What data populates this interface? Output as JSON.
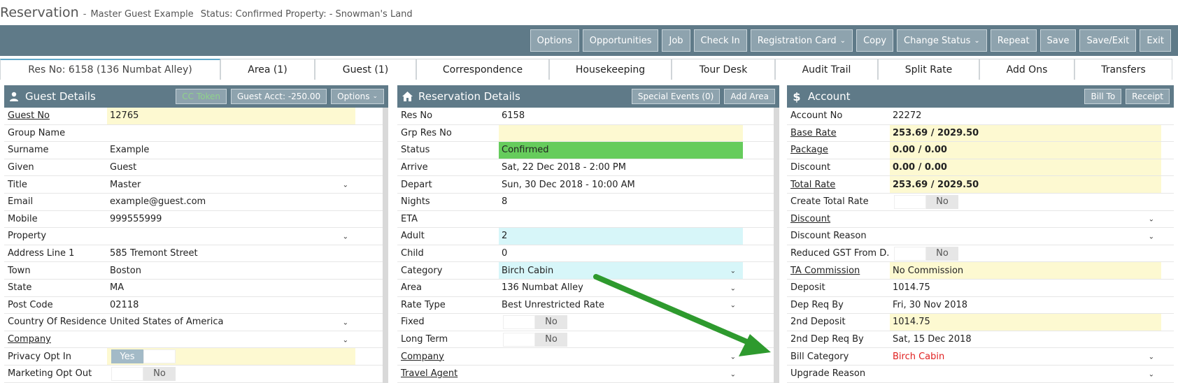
{
  "header": {
    "title": "Reservation",
    "separator": "-",
    "guest": "Master Guest Example",
    "status": "Status: Confirmed",
    "property": "Property: - Snowman's Land"
  },
  "toolbar": {
    "buttons": [
      "Options",
      "Opportunities",
      "Job",
      "Check In",
      "Registration Card",
      "Copy",
      "Change Status",
      "Repeat",
      "Save",
      "Save/Exit",
      "Exit"
    ]
  },
  "tabs": [
    "Res No: 6158 (136 Numbat Alley)",
    "Area (1)",
    "Guest (1)",
    "Correspondence",
    "Housekeeping",
    "Tour Desk",
    "Audit Trail",
    "Split Rate",
    "Add Ons",
    "Transfers"
  ],
  "guest_panel": {
    "title": "Guest Details",
    "cc_token": "CC Token",
    "guest_acct": "Guest Acct: -250.00",
    "options": "Options",
    "rows": [
      {
        "label": "Guest No",
        "value": "12765"
      },
      {
        "label": "Group Name",
        "value": ""
      },
      {
        "label": "Surname",
        "value": "Example"
      },
      {
        "label": "Given",
        "value": "Guest"
      },
      {
        "label": "Title",
        "value": "Master"
      },
      {
        "label": "Email",
        "value": "example@guest.com"
      },
      {
        "label": "Mobile",
        "value": "999555999"
      },
      {
        "label": "Property",
        "value": ""
      },
      {
        "label": "Address Line 1",
        "value": "585 Tremont Street"
      },
      {
        "label": "Town",
        "value": "Boston"
      },
      {
        "label": "State",
        "value": "MA"
      },
      {
        "label": "Post Code",
        "value": "02118"
      },
      {
        "label": "Country Of Residence",
        "value": "United States of America"
      },
      {
        "label": "Company",
        "value": ""
      },
      {
        "label": "Privacy Opt In",
        "value": "Yes"
      },
      {
        "label": "Marketing Opt Out",
        "value": "No"
      }
    ]
  },
  "reservation_panel": {
    "title": "Reservation Details",
    "special_events": "Special Events (0)",
    "add_area": "Add Area",
    "rows": [
      {
        "label": "Res No",
        "value": "6158"
      },
      {
        "label": "Grp Res No",
        "value": ""
      },
      {
        "label": "Status",
        "value": "Confirmed"
      },
      {
        "label": "Arrive",
        "value": "Sat, 22 Dec 2018 - 2:00 PM"
      },
      {
        "label": "Depart",
        "value": "Sun, 30 Dec 2018 - 10:00 AM"
      },
      {
        "label": "Nights",
        "value": "8"
      },
      {
        "label": "ETA",
        "value": ""
      },
      {
        "label": "Adult",
        "value": "2"
      },
      {
        "label": "Child",
        "value": "0"
      },
      {
        "label": "Category",
        "value": "Birch Cabin"
      },
      {
        "label": "Area",
        "value": "136 Numbat Alley"
      },
      {
        "label": "Rate Type",
        "value": "Best Unrestricted Rate"
      },
      {
        "label": "Fixed",
        "value": "No"
      },
      {
        "label": "Long Term",
        "value": "No"
      },
      {
        "label": "Company",
        "value": ""
      },
      {
        "label": "Travel Agent",
        "value": ""
      }
    ]
  },
  "account_panel": {
    "title": "Account",
    "bill_to": "Bill To",
    "receipt": "Receipt",
    "rows": [
      {
        "label": "Account No",
        "value": "22272"
      },
      {
        "label": "Base Rate",
        "value": "253.69 / 2029.50"
      },
      {
        "label": "Package",
        "value": "0.00 / 0.00"
      },
      {
        "label": "Discount",
        "value": "0.00 / 0.00"
      },
      {
        "label": "Total Rate",
        "value": "253.69 / 2029.50"
      },
      {
        "label": "Create Total Rate",
        "value": "No"
      },
      {
        "label": "Discount",
        "value": ""
      },
      {
        "label": "Discount Reason",
        "value": ""
      },
      {
        "label": "Reduced GST From D...",
        "value": "No"
      },
      {
        "label": "TA Commission",
        "value": "No Commission"
      },
      {
        "label": "Deposit",
        "value": "1014.75"
      },
      {
        "label": "Dep Req By",
        "value": "Fri, 30 Nov 2018"
      },
      {
        "label": "2nd Deposit",
        "value": "1014.75"
      },
      {
        "label": "2nd Dep Req By",
        "value": "Sat, 15 Dec 2018"
      },
      {
        "label": "Bill Category",
        "value": "Birch Cabin"
      },
      {
        "label": "Upgrade Reason",
        "value": ""
      }
    ]
  },
  "colors": {
    "toolbar_bg": "#5f7a88",
    "confirmed_green": "#66cc5c",
    "highlight_yellow": "#fdf9d1",
    "arrow_green": "#2e9a2e",
    "bill_category_red": "#e02020"
  }
}
